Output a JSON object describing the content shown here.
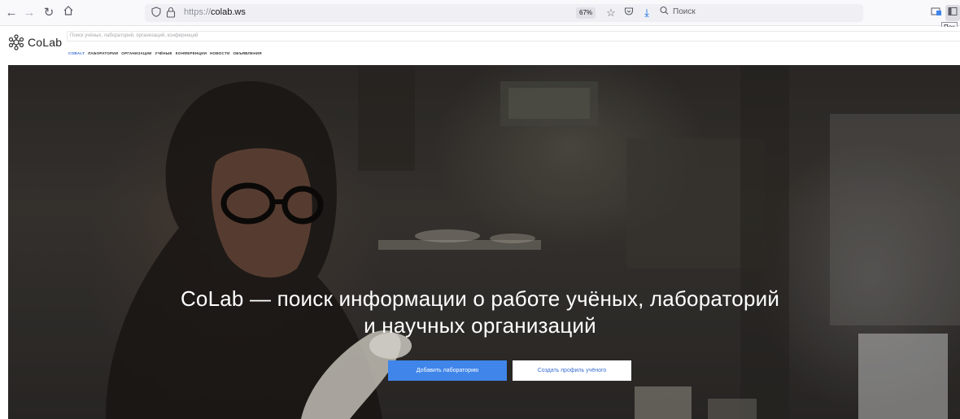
{
  "browser": {
    "url_prefix": "https://",
    "url_host": "colab.ws",
    "zoom": "67%",
    "search_placeholder": "Поиск",
    "tooltip": "Пок"
  },
  "site": {
    "logo_text": "CoLab",
    "search_placeholder": "Поиск учёных, лабораторий, организаций, конференций",
    "nav": [
      "COBALT",
      "ЛАБОРАТОРИИ",
      "ОРГАНИЗАЦИИ",
      "УЧЁНЫЕ",
      "КОНФЕРЕНЦИИ",
      "НОВОСТИ",
      "ОБЪЯВЛЕНИЯ"
    ]
  },
  "hero": {
    "title_line1": "CoLab — поиск информации о работе учёных, лабораторий",
    "title_line2": "и научных организаций",
    "primary_button": "Добавить лабораторию",
    "secondary_button": "Создать профиль учёного"
  },
  "colors": {
    "accent": "#3f85ea",
    "link": "#3b6fd4"
  }
}
